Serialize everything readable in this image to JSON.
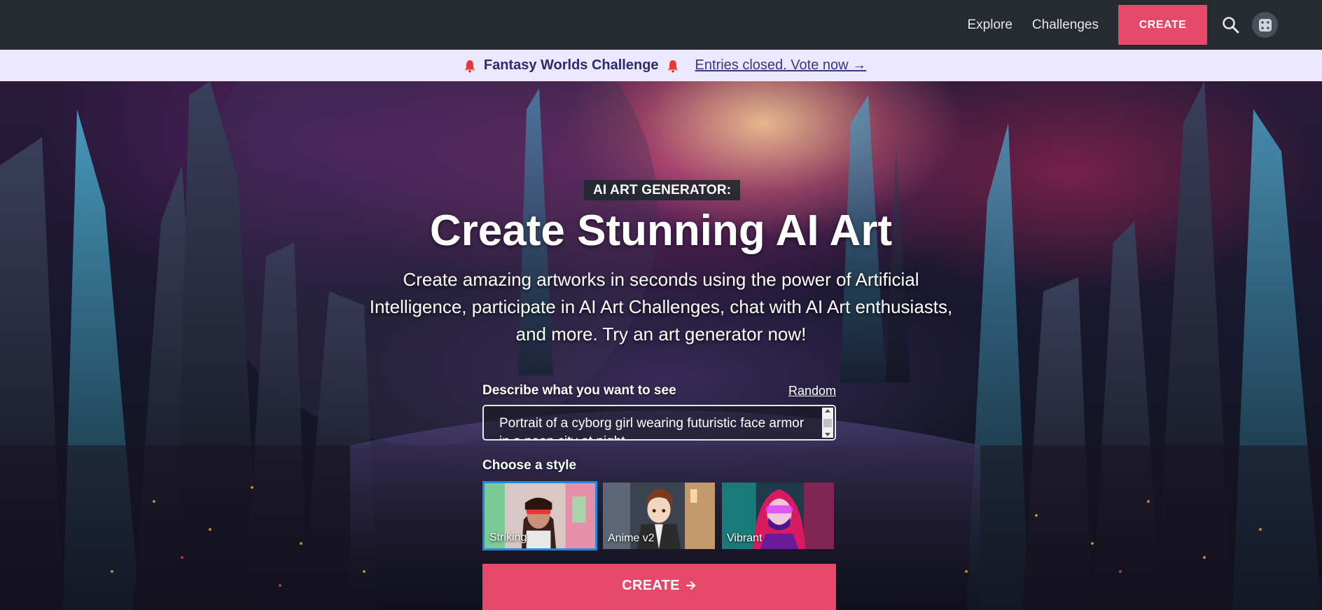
{
  "nav": {
    "explore_label": "Explore",
    "challenges_label": "Challenges",
    "create_label": "CREATE",
    "search_icon": "search-icon",
    "avatar_icon": "dice-icon"
  },
  "banner": {
    "title": "Fantasy Worlds Challenge",
    "link_text": "Entries closed. Vote now →",
    "icon": "bell-icon"
  },
  "hero": {
    "badge": "AI ART GENERATOR:",
    "title": "Create Stunning AI Art",
    "subtitle": "Create amazing artworks in seconds using the power of Artificial Intelligence, participate in AI Art Challenges, chat with AI Art enthusiasts, and more. Try an art generator now!"
  },
  "form": {
    "prompt_label": "Describe what you want to see",
    "random_label": "Random",
    "prompt_value": "Portrait of a cyborg girl wearing futuristic face armor in a neon city at night",
    "style_label": "Choose a style",
    "styles": [
      {
        "name": "Striking",
        "selected": true
      },
      {
        "name": "Anime v2",
        "selected": false
      },
      {
        "name": "Vibrant",
        "selected": false
      }
    ],
    "create_label": "CREATE"
  },
  "colors": {
    "accent": "#e54868",
    "nav_bg": "#262a31",
    "banner_bg": "#ece8ff",
    "selected_border": "#1e88e5"
  }
}
